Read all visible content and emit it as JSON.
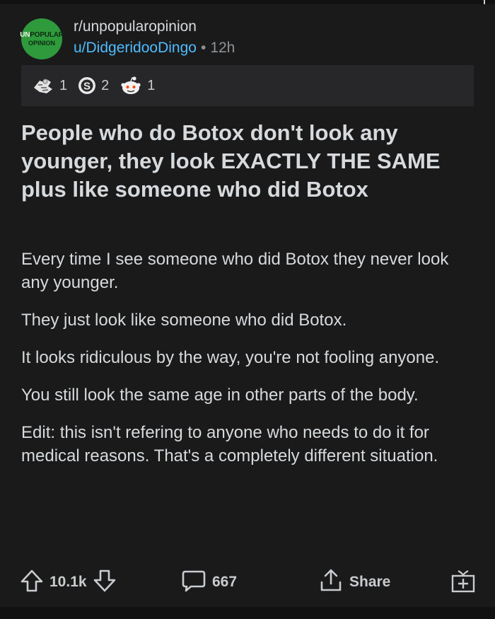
{
  "subreddit": {
    "name": "r/unpopularopinion",
    "avatar_line1_prefix": "UN",
    "avatar_line1_rest": "POPULAR",
    "avatar_line2": "OPINION"
  },
  "post_meta": {
    "author": "u/DidgeridooDingo",
    "separator": "•",
    "age": "12h"
  },
  "awards": [
    {
      "icon": "helpful-hands-award-icon",
      "count": "1"
    },
    {
      "icon": "silver-award-icon",
      "count": "2"
    },
    {
      "icon": "snoo-wholesome-award-icon",
      "count": "1"
    }
  ],
  "post": {
    "title": "People who do Botox don't look any younger, they look EXACTLY THE SAME plus like someone who did Botox",
    "paragraphs": [
      "Every time I see someone who did Botox they never look any younger.",
      "They just look like someone who did Botox.",
      "It looks ridiculous by the way, you're not fooling anyone.",
      "You still look the same age in other parts of the body.",
      "Edit: this isn't refering to anyone who needs to do it for medical reasons. That's a completely different situation."
    ]
  },
  "actions": {
    "score": "10.1k",
    "comments": "667",
    "share_label": "Share",
    "upvote_icon": "upvote-arrow-icon",
    "downvote_icon": "downvote-arrow-icon",
    "comment_icon": "comment-bubble-icon",
    "share_icon": "share-icon",
    "award_icon": "give-award-icon"
  },
  "colors": {
    "background": "#1a1a1b",
    "text": "#d7dadc",
    "link_blue": "#4fbcff",
    "muted": "#8f9295",
    "award_strip": "#272729",
    "sub_avatar_green": "#2e9a3b"
  }
}
